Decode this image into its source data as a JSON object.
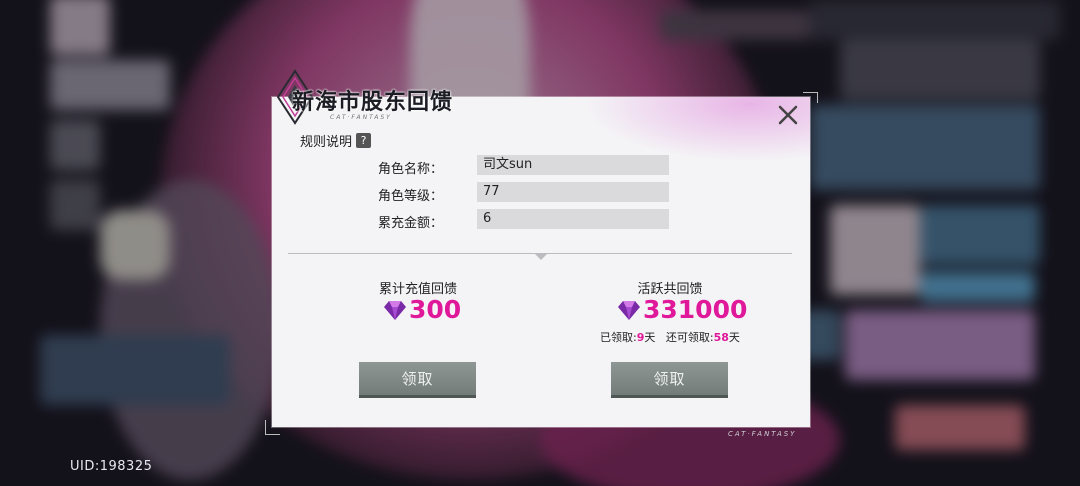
{
  "dialog": {
    "title": "新海市股东回馈",
    "subtitle": "CAT·FANTASY",
    "rules_label": "规则说明",
    "help_glyph": "?",
    "close_glyph": "✕"
  },
  "fields": [
    {
      "label": "角色名称：",
      "value": "司文sun"
    },
    {
      "label": "角色等级：",
      "value": "77"
    },
    {
      "label": "累充金额：",
      "value": "6"
    }
  ],
  "rewards": {
    "recharge": {
      "title": "累计充值回馈",
      "amount": "300",
      "claim_label": "领取"
    },
    "active": {
      "title": "活跃共回馈",
      "amount": "331000",
      "claimed_prefix": "已领取:",
      "claimed_days": "9",
      "remaining_prefix": "还可领取:",
      "remaining_days": "58",
      "days_unit": "天",
      "claim_label": "领取"
    }
  },
  "footer": {
    "uid": "UID:198325",
    "brand": "CAT·FANTASY"
  },
  "icons": {
    "close": "close-icon",
    "help": "question-icon",
    "gem": "diamond-gem-icon",
    "emblem": "diamond-emblem-icon"
  },
  "colors": {
    "accent": "#e0199a",
    "button": "#7f8885",
    "dialog_bg": "#f4f4f6",
    "field_bg": "#dadadc"
  }
}
